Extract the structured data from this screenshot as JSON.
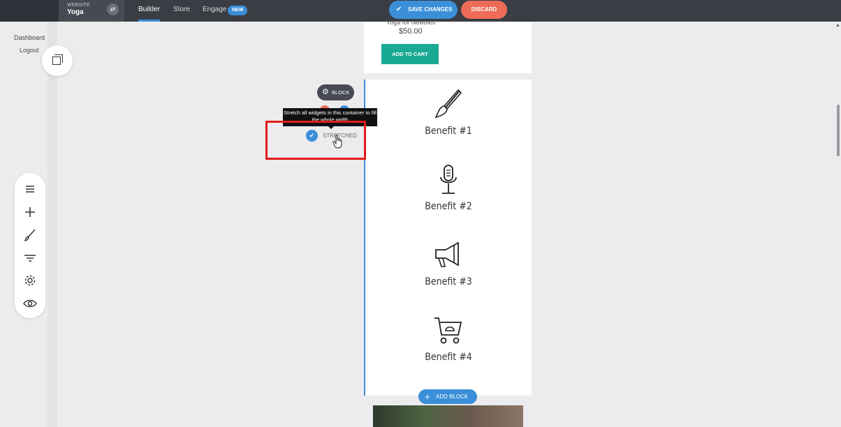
{
  "topbar": {
    "website_label": "WEBSITE",
    "website_name": "Yoga",
    "tabs": [
      {
        "label": "Builder",
        "active": true
      },
      {
        "label": "Store",
        "active": false
      },
      {
        "label": "Engage",
        "active": false
      }
    ],
    "new_badge": "NEW",
    "save_label": "SAVE CHANGES",
    "discard_label": "DISCARD"
  },
  "sidebar": {
    "links": [
      "Dashboard",
      "Logout"
    ],
    "tools": [
      "menu-icon",
      "plus-icon",
      "brush-icon",
      "filter-icon",
      "gear-icon",
      "eye-icon"
    ]
  },
  "product": {
    "name": "Yoga for Newbies",
    "price": "$50.00",
    "cta": "ADD TO CART"
  },
  "block_controls": {
    "block_label": "BLOCK",
    "tooltip": "Stretch all widgets in this container to fill the whole width",
    "stretched_label": "STRETCHED"
  },
  "benefits": [
    {
      "title": "Benefit #1",
      "icon": "paintbrush-icon"
    },
    {
      "title": "Benefit #2",
      "icon": "microphone-icon"
    },
    {
      "title": "Benefit #3",
      "icon": "megaphone-icon"
    },
    {
      "title": "Benefit #4",
      "icon": "shopping-cart-icon"
    }
  ],
  "add_block_label": "ADD BLOCK",
  "colors": {
    "topbar": "#3a3d44",
    "accent": "#3b8fd8",
    "discard": "#ee6c57",
    "cta": "#1aaa93",
    "highlight": "#e41b1b"
  }
}
